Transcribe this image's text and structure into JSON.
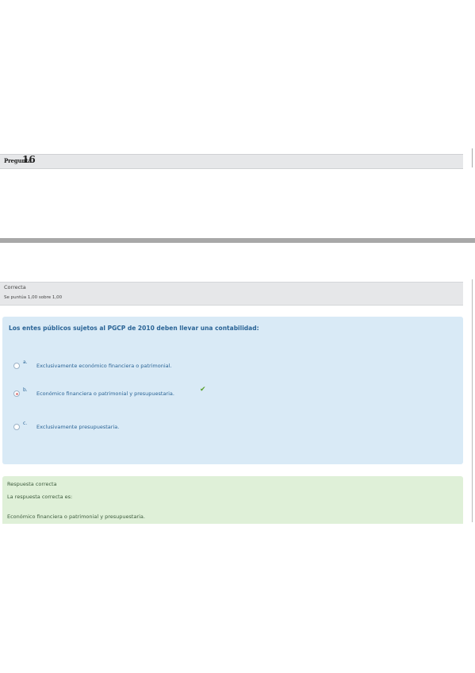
{
  "question": {
    "prefix": "Pregunta",
    "number": "16"
  },
  "info": {
    "state": "Correcta",
    "grade": "Se puntúa 1,00 sobre 1,00"
  },
  "formulation": {
    "question_text": "Los entes públicos sujetos al PGCP de 2010 deben llevar una contabilidad:",
    "options": [
      {
        "letter": "a.",
        "text": "Exclusivamente económico financiera o patrimonial.",
        "selected": false,
        "correct_mark": ""
      },
      {
        "letter": "b.",
        "text": "Económico financiera o patrimonial y presupuestaria.",
        "selected": true,
        "correct_mark": "✔"
      },
      {
        "letter": "c.",
        "text": "Exclusivamente presupuestaria.",
        "selected": false,
        "correct_mark": ""
      }
    ]
  },
  "feedback": {
    "title": "Respuesta correcta",
    "label": "La respuesta correcta es:",
    "answer": "Económico financiera o patrimonial y presupuestaria."
  },
  "colors": {
    "info_bg": "#e6e7e9",
    "formulation_bg": "#d9eaf6",
    "feedback_bg": "#dff0d8",
    "question_text": "#2a6496",
    "check": "#5aa02c"
  }
}
